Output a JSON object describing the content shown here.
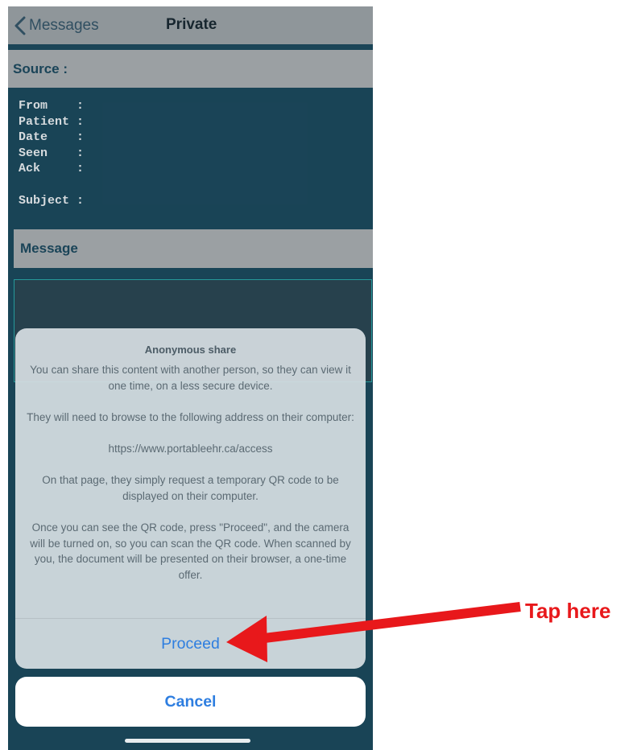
{
  "nav": {
    "back_label": "Messages",
    "title": "Private"
  },
  "source": {
    "label": "Source :",
    "fields": [
      {
        "name": "From",
        "sep": ":"
      },
      {
        "name": "Patient",
        "sep": ":"
      },
      {
        "name": "Date",
        "sep": ":"
      },
      {
        "name": "Seen",
        "sep": ":"
      },
      {
        "name": "Ack",
        "sep": ":"
      },
      {
        "name": "Subject",
        "sep": ":"
      }
    ]
  },
  "message": {
    "label": "Message"
  },
  "share_sheet": {
    "title": "Anonymous share",
    "paragraphs": [
      "You can share this content with another person, so they can view it one time, on a less secure device.",
      "They will need to browse to the following address on their computer:",
      "https://www.portableehr.ca/access",
      "On that page, they simply request a temporary QR code to be displayed on their computer.",
      "Once you can see the QR code, press \"Proceed\", and the camera will be turned on, so you can scan the QR code. When scanned by you, the document will be presented on their browser, a one-time offer."
    ],
    "proceed_label": "Proceed",
    "cancel_label": "Cancel"
  },
  "annotation": {
    "text": "Tap here",
    "color": "#e8181b"
  },
  "colors": {
    "background": "#1c4a5e",
    "accent": "#2e7ee0"
  }
}
